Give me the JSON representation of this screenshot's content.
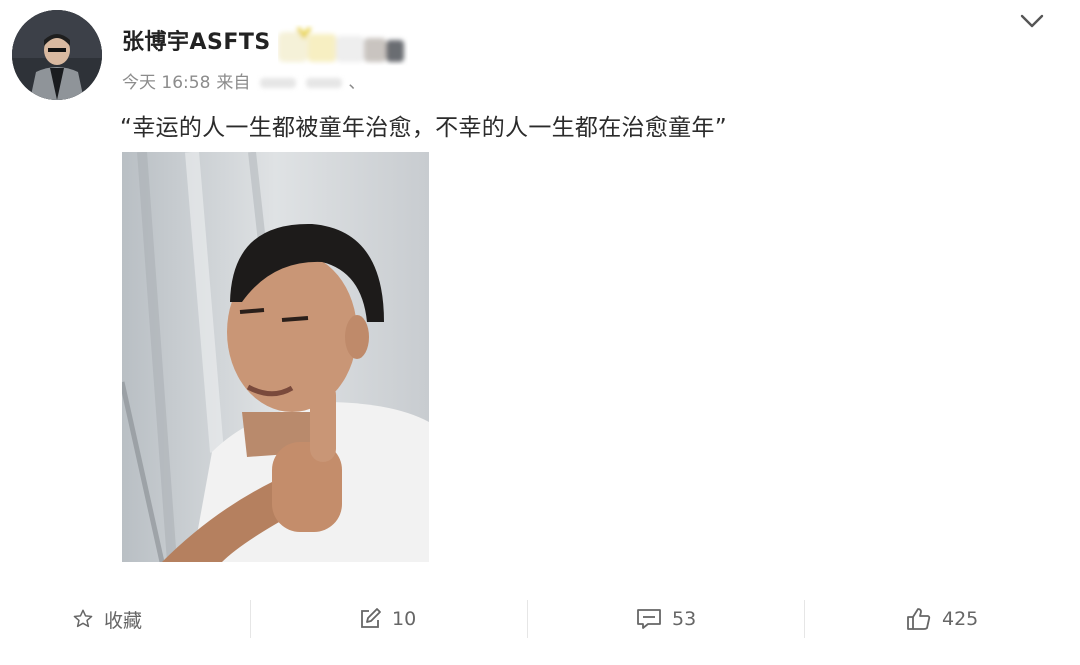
{
  "post": {
    "author": "张博宇ASFTS",
    "time": "今天 16:58",
    "source_prefix": "来自",
    "source_tail": "、",
    "text": "“幸运的人一生都被童年治愈，不幸的人一生都在治愈童年”"
  },
  "actions": {
    "favorite_label": "收藏",
    "repost_count": "10",
    "comment_count": "53",
    "like_count": "425"
  },
  "icons": {
    "menu": "chevron-down-icon",
    "favorite": "star-icon",
    "repost": "edit-icon",
    "comment": "comment-icon",
    "like": "thumbs-up-icon"
  }
}
